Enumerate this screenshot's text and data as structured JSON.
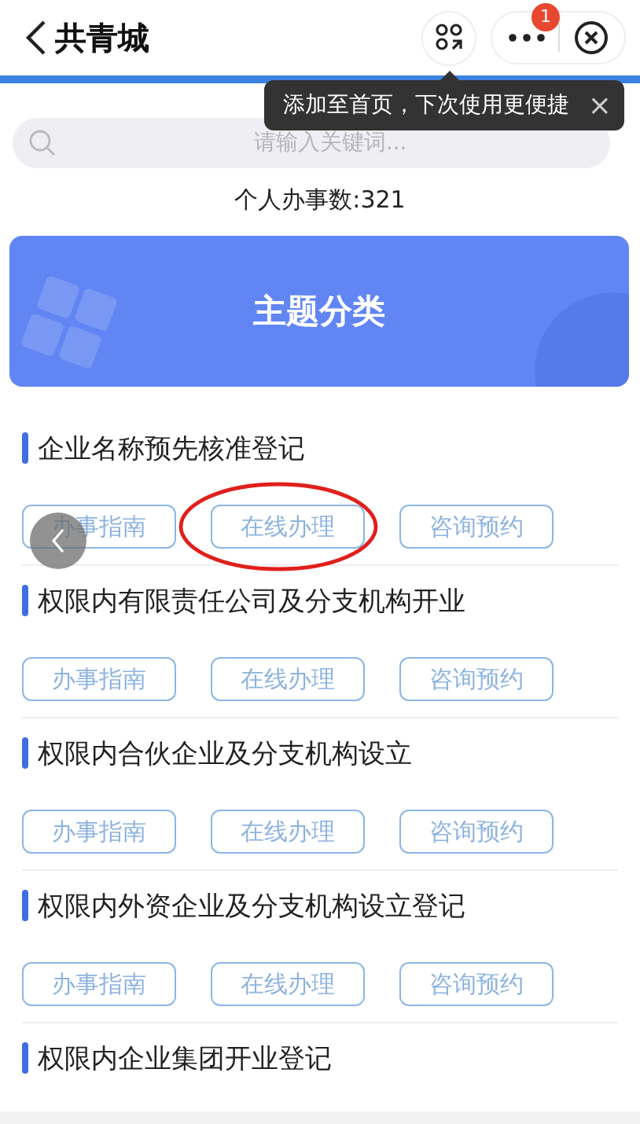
{
  "header": {
    "title": "共青城",
    "badge": "1"
  },
  "tooltip": {
    "text": "添加至首页，下次使用更便捷",
    "close": "×"
  },
  "search": {
    "placeholder": "请输入关键词..."
  },
  "count": "个人办事数:321",
  "banner": {
    "title": "主题分类"
  },
  "items": [
    {
      "title": "企业名称预先核准登记",
      "buttons": [
        "办事指南",
        "在线办理",
        "咨询预约"
      ]
    },
    {
      "title": "权限内有限责任公司及分支机构开业",
      "buttons": [
        "办事指南",
        "在线办理",
        "咨询预约"
      ]
    },
    {
      "title": "权限内合伙企业及分支机构设立",
      "buttons": [
        "办事指南",
        "在线办理",
        "咨询预约"
      ]
    },
    {
      "title": "权限内外资企业及分支机构设立登记",
      "buttons": [
        "办事指南",
        "在线办理",
        "咨询预约"
      ]
    },
    {
      "title": "权限内企业集团开业登记"
    }
  ]
}
